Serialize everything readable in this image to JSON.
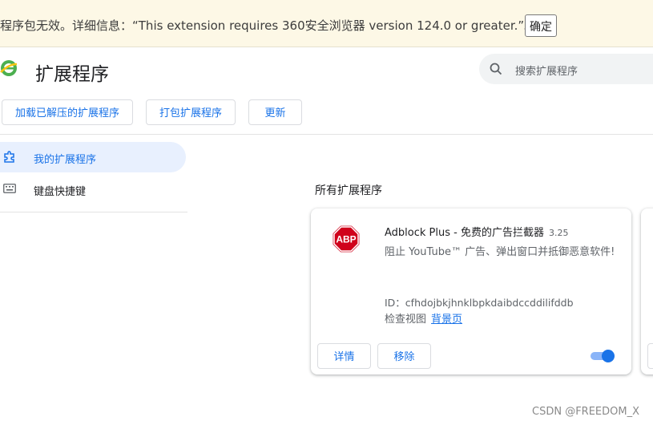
{
  "warning": {
    "message": "程序包无效。详细信息：“This extension requires 360安全浏览器 version 124.0 or greater.”。",
    "confirm_label": "确定"
  },
  "header": {
    "title": "扩展程序",
    "search_placeholder": "搜索扩展程序"
  },
  "toolbar": {
    "load_unpacked": "加载已解压的扩展程序",
    "pack": "打包扩展程序",
    "update": "更新"
  },
  "sidebar": {
    "items": [
      {
        "label": "我的扩展程序",
        "icon": "puzzle-icon",
        "active": true
      },
      {
        "label": "键盘快捷键",
        "icon": "keyboard-icon",
        "active": false
      }
    ]
  },
  "main": {
    "section_title": "所有扩展程序",
    "extensions": [
      {
        "name": "Adblock Plus - 免费的广告拦截器",
        "version": "3.25",
        "description": "阻止 YouTube™ 广告、弹出窗口并抵御恶意软件!",
        "id_label": "ID：cfhdojbkjhnklbpkdaibdccddilifddb",
        "inspect_label": "检查视图",
        "inspect_link": "背景页",
        "details_label": "详情",
        "remove_label": "移除",
        "enabled": true,
        "icon_text": "ABP"
      }
    ]
  },
  "watermark": "CSDN @FREEDOM_X",
  "colors": {
    "accent": "#1a73e8",
    "warning_bg": "#fdf8e6",
    "active_nav_bg": "#e8f0fe",
    "abp_red": "#d0021b"
  }
}
